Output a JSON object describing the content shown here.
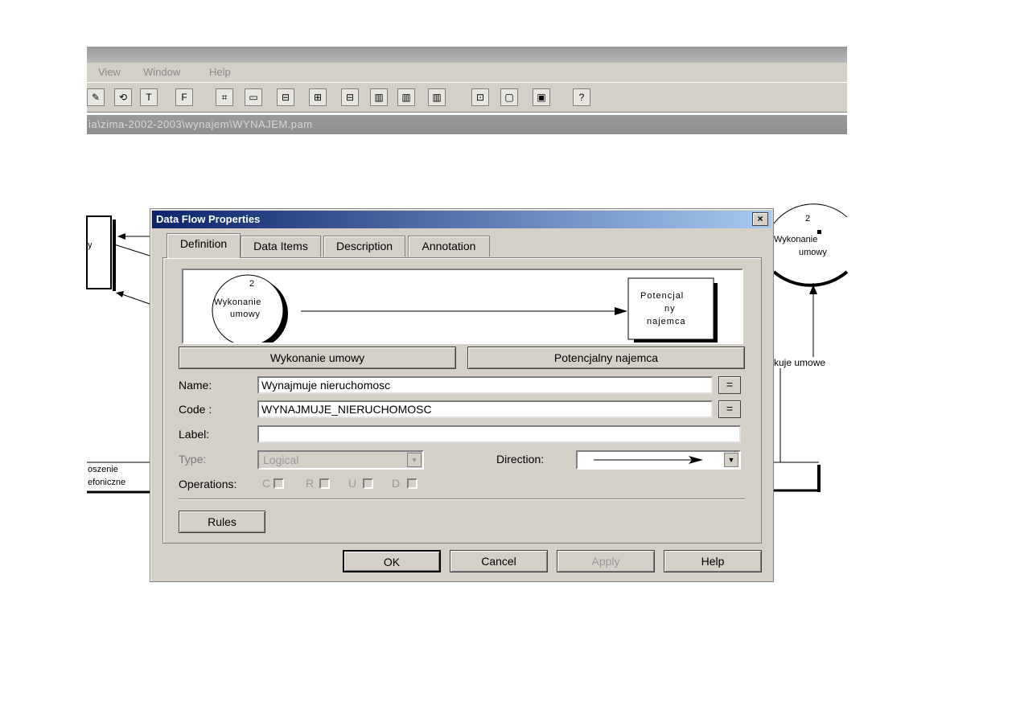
{
  "menu": {
    "items": [
      "View",
      "Window",
      "Help"
    ]
  },
  "toolbar": {
    "buttons": [
      "✎",
      "⟲",
      "T",
      "F",
      "⌗",
      "▭",
      "⊟",
      "⊞",
      "⊟",
      "▥",
      "▥",
      "▥",
      "⊡",
      "▢",
      "▣",
      "?"
    ]
  },
  "path": {
    "text": "ia\\zima-2002-2003\\wynajem\\WYNAJEM.pam"
  },
  "background": {
    "left_text_1": "y",
    "left_text_2": "oszenie",
    "left_text_3": "efoniczne",
    "right_circle_num": "2",
    "right_circle_label_1": "Wykonanie",
    "right_circle_label_2": "umowy",
    "right_flow_label": "kuje umowe"
  },
  "dialog": {
    "title": "Data Flow Properties",
    "close": "×",
    "tabs": [
      "Definition",
      "Data Items",
      "Description",
      "Annotation"
    ],
    "preview": {
      "process_number": "2",
      "process_label_1": "Wykonanie",
      "process_label_2": "umowy",
      "entity_label_1": "Potencjal",
      "entity_label_2": "ny",
      "entity_label_3": "najemca"
    },
    "source_button": "Wykonanie umowy",
    "dest_button": "Potencjalny najemca",
    "name_label": "Name:",
    "name_value": "Wynajmuje nieruchomosc",
    "code_label": "Code :",
    "code_value": "WYNAJMUJE_NIERUCHOMOSC",
    "label_label": "Label:",
    "label_value": "",
    "eq": "=",
    "type_label": "Type:",
    "type_value": "Logical",
    "direction_label": "Direction:",
    "operations_label": "Operations:",
    "operations": [
      "C",
      "R",
      "U",
      "D"
    ],
    "rules_button": "Rules",
    "ok_button": "OK",
    "cancel_button": "Cancel",
    "apply_button": "Apply",
    "help_button": "Help"
  }
}
